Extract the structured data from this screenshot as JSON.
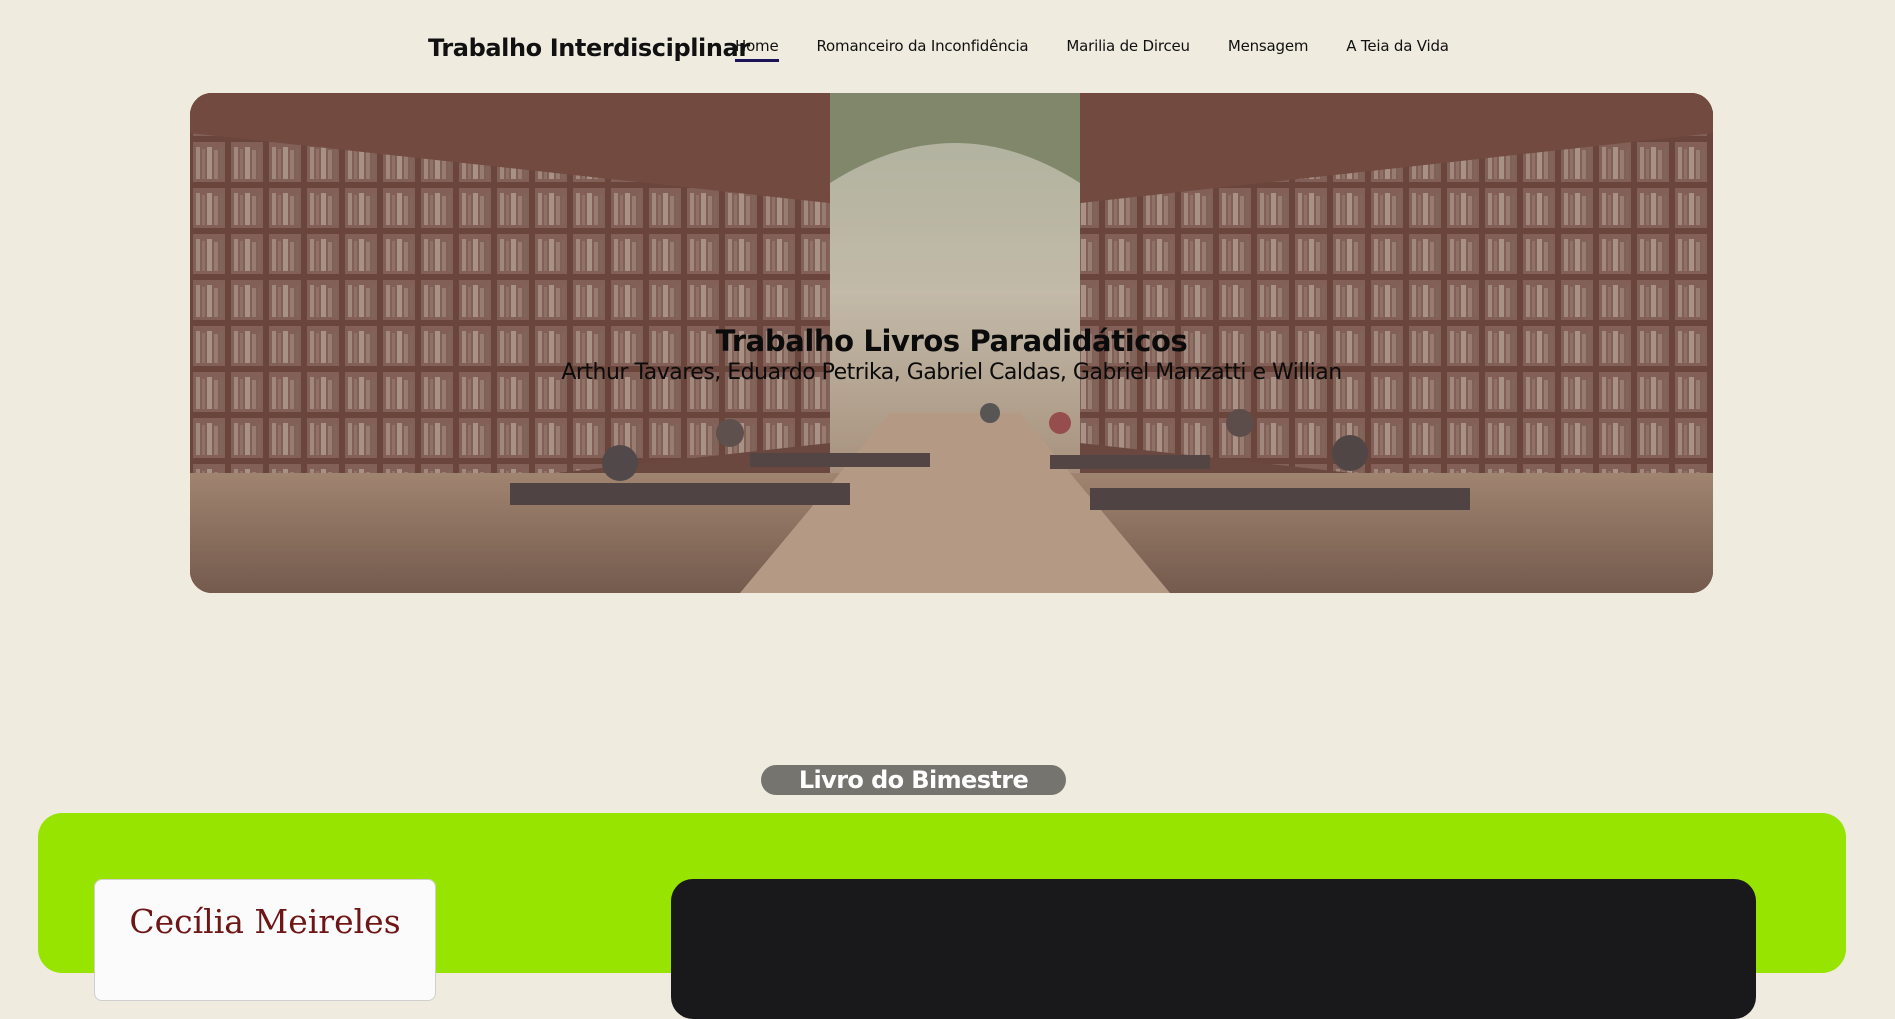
{
  "header": {
    "brand": "Trabalho Interdisciplinar",
    "nav": [
      {
        "label": "Home",
        "active": true
      },
      {
        "label": "Romanceiro da Inconfidência",
        "active": false
      },
      {
        "label": "Marilia de Dirceu",
        "active": false
      },
      {
        "label": "Mensagem",
        "active": false
      },
      {
        "label": "A Teia da Vida",
        "active": false
      }
    ]
  },
  "hero": {
    "title": "Trabalho Livros Paradidáticos",
    "subtitle": "Arthur Tavares, Eduardo Petrika, Gabriel Caldas, Gabriel Manzatti e Willian",
    "image": "library-reading-room-photo"
  },
  "section": {
    "title": "Livro do Bimestre"
  },
  "book": {
    "cover_author": "Cecília Meireles"
  },
  "colors": {
    "page_background": "#efebdf",
    "active_underline": "#1b1458",
    "section_pill": "#75746f",
    "book_panel": "#97e400",
    "video_frame": "#19191b"
  }
}
